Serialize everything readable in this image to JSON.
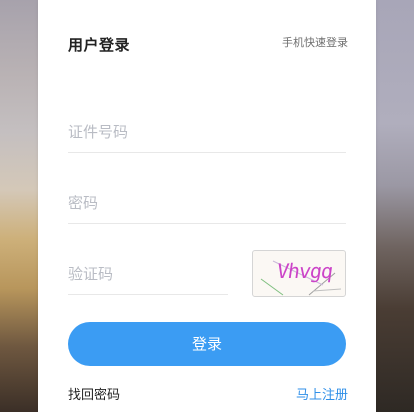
{
  "login": {
    "title": "用户登录",
    "quick_login": "手机快速登录",
    "id_placeholder": "证件号码",
    "password_placeholder": "密码",
    "captcha_placeholder": "验证码",
    "captcha_text": "Vhvgq",
    "submit_label": "登录",
    "forgot_label": "找回密码",
    "register_label": "马上注册"
  },
  "colors": {
    "accent": "#3b9cf3",
    "link": "#2f8fe8",
    "captcha_text": "#cc44c8"
  }
}
